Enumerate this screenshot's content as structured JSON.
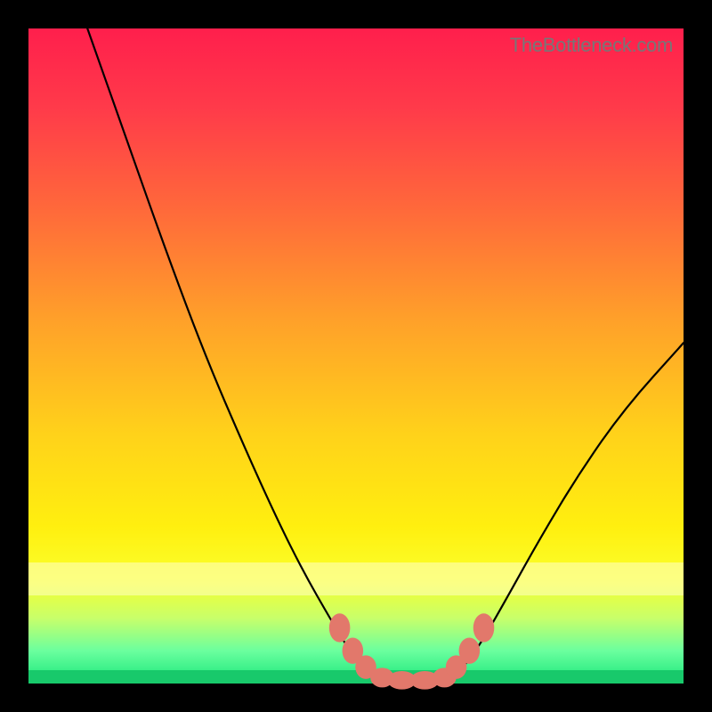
{
  "attribution": "TheBottleneck.com",
  "chart_data": {
    "type": "line",
    "title": "",
    "xlabel": "",
    "ylabel": "",
    "xlim": [
      0,
      100
    ],
    "ylim": [
      0,
      100
    ],
    "series": [
      {
        "name": "left-curve",
        "x": [
          9,
          15,
          21,
          27,
          33,
          38,
          42,
          46,
          49,
          51.5,
          53,
          54
        ],
        "y": [
          100,
          83,
          66,
          50,
          36,
          25,
          17,
          10,
          5,
          2.5,
          1,
          0.5
        ]
      },
      {
        "name": "floor",
        "x": [
          54,
          56,
          58,
          60,
          62,
          64
        ],
        "y": [
          0.5,
          0.2,
          0.1,
          0.1,
          0.2,
          0.5
        ]
      },
      {
        "name": "right-curve",
        "x": [
          64,
          66,
          69,
          73,
          78,
          84,
          91,
          100
        ],
        "y": [
          0.5,
          2,
          6,
          13,
          22,
          32,
          42,
          52
        ]
      }
    ],
    "markers": [
      {
        "x": 47.5,
        "y": 8.5,
        "rx": 1.6,
        "ry": 2.2
      },
      {
        "x": 49.5,
        "y": 5.0,
        "rx": 1.6,
        "ry": 2.0
      },
      {
        "x": 51.5,
        "y": 2.5,
        "rx": 1.6,
        "ry": 1.8
      },
      {
        "x": 54.0,
        "y": 0.9,
        "rx": 1.8,
        "ry": 1.5
      },
      {
        "x": 57.0,
        "y": 0.5,
        "rx": 2.2,
        "ry": 1.4
      },
      {
        "x": 60.5,
        "y": 0.5,
        "rx": 2.2,
        "ry": 1.4
      },
      {
        "x": 63.5,
        "y": 0.9,
        "rx": 1.8,
        "ry": 1.5
      },
      {
        "x": 65.3,
        "y": 2.5,
        "rx": 1.6,
        "ry": 1.8
      },
      {
        "x": 67.3,
        "y": 5.0,
        "rx": 1.6,
        "ry": 2.0
      },
      {
        "x": 69.5,
        "y": 8.5,
        "rx": 1.6,
        "ry": 2.2
      }
    ],
    "gradient_bands": [
      {
        "name": "pale-yellow",
        "from_y": 13.5,
        "to_y": 18.5
      },
      {
        "name": "green-stripe",
        "from_y": 0,
        "to_y": 2
      }
    ]
  }
}
